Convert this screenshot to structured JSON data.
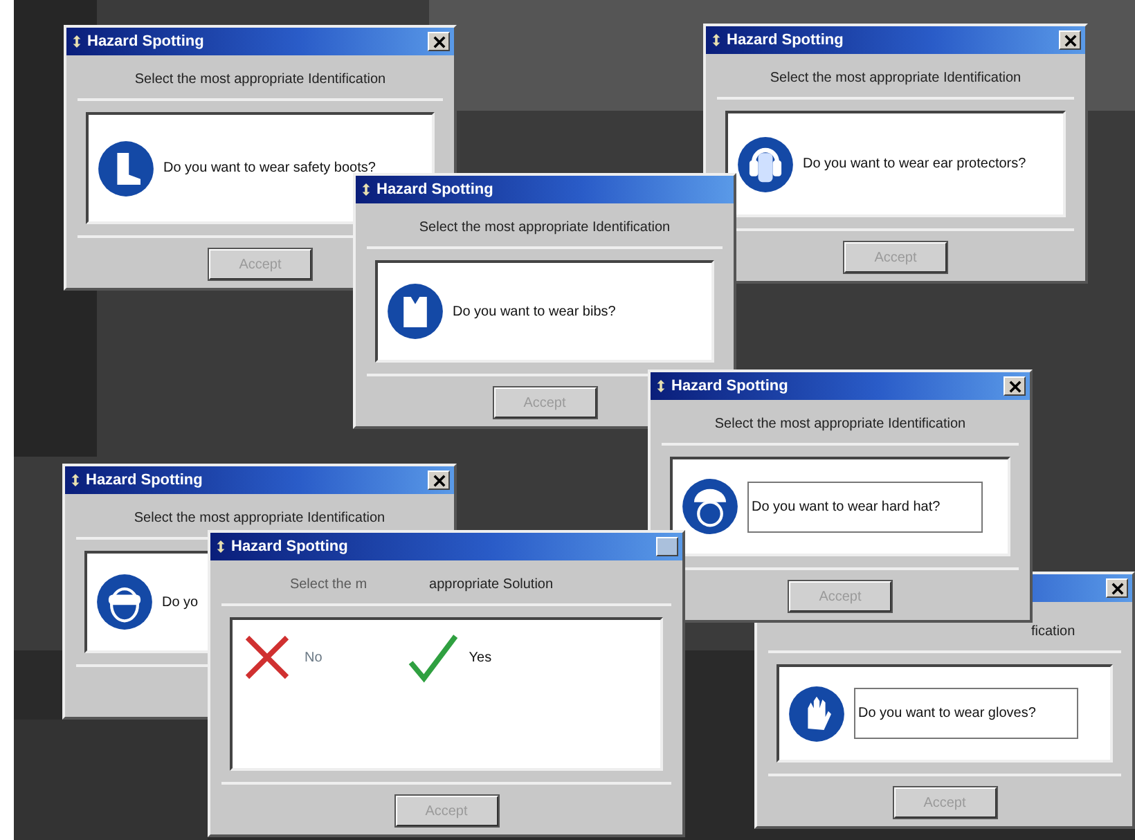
{
  "windows": [
    {
      "kind": "question",
      "title": "Hazard Spotting",
      "close": {
        "disabled": false
      },
      "prompt": [
        {
          "text": "Select the most appropriate Identification",
          "faded": false
        }
      ],
      "question": "Do you want to wear safety boots?",
      "button": {
        "label": "Accept",
        "disabled": true
      }
    },
    {
      "kind": "question",
      "title": "Hazard Spotting",
      "close": {
        "disabled": false
      },
      "prompt": [
        {
          "text": "Select the most appropriate Identification",
          "faded": false
        }
      ],
      "question": "Do you want to wear ear protectors?",
      "button": {
        "label": "Accept",
        "disabled": true
      }
    },
    {
      "kind": "question",
      "close": {
        "disabled": false
      },
      "prompt": [
        {
          "text": "fication",
          "faded": false
        }
      ],
      "question": "Do you want to wear gloves?",
      "button": {
        "label": "Accept",
        "disabled": true
      }
    },
    {
      "kind": "question",
      "title": "Hazard Spotting",
      "close": {
        "disabled": false
      },
      "prompt": [
        {
          "text": "Select the most appropriate Identification",
          "faded": false
        }
      ],
      "question": "Do yo"
    },
    {
      "kind": "question",
      "title": "Hazard Spotting",
      "prompt": [
        {
          "text": "Select the most appropriate Identification",
          "faded": false
        }
      ],
      "question": "Do you want to wear bibs?",
      "button": {
        "label": "Accept",
        "disabled": true
      }
    },
    {
      "kind": "question",
      "title": "Hazard Spotting",
      "close": {
        "disabled": false
      },
      "prompt": [
        {
          "text": "Select the most appropriate Identification",
          "faded": false
        }
      ],
      "question": "Do you want to wear hard hat?",
      "button": {
        "label": "Accept",
        "disabled": true
      }
    },
    {
      "kind": "choice",
      "title": "Hazard Spotting",
      "close": {
        "disabled": true
      },
      "prompt": [
        {
          "text": "Select the m",
          "faded": true
        },
        {
          "text": "appropriate Solution",
          "faded": false
        }
      ],
      "options": [
        {
          "kind": "no",
          "label": "No",
          "faded": true
        },
        {
          "kind": "yes",
          "label": "Yes",
          "faded": false
        }
      ],
      "button": {
        "label": "Accept",
        "disabled": true
      }
    }
  ]
}
